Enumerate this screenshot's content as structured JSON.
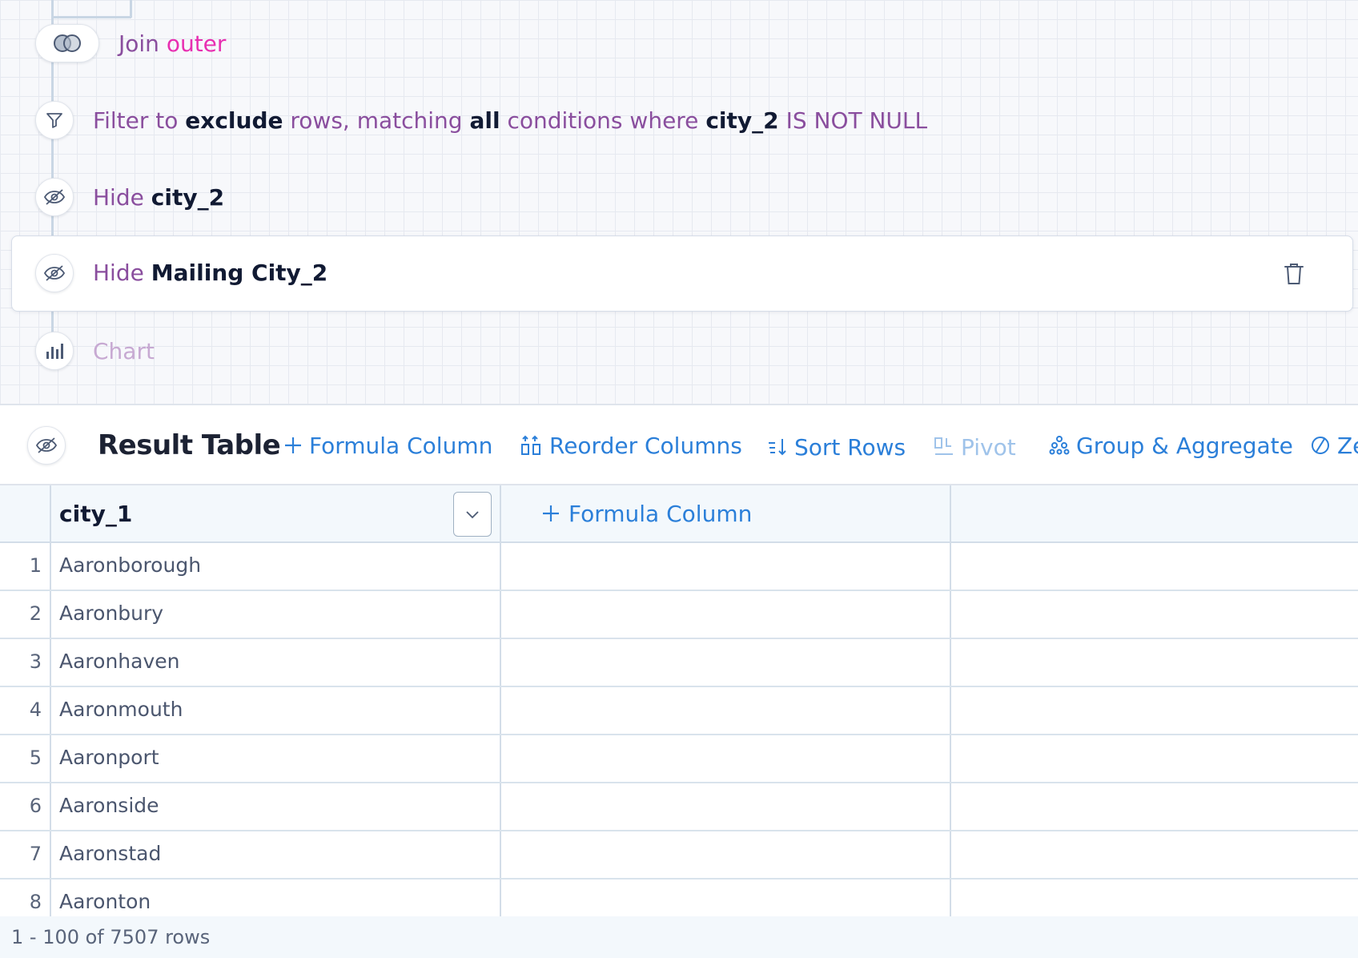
{
  "pipeline": {
    "join": {
      "prefix": "Join",
      "type": "outer"
    },
    "filter": {
      "parts": [
        "Filter to",
        "exclude",
        "rows, matching",
        "all",
        "conditions where",
        "city_2",
        "IS NOT NULL"
      ]
    },
    "hide1": {
      "verb": "Hide",
      "column": "city_2"
    },
    "hide2": {
      "verb": "Hide",
      "column": "Mailing City_2"
    },
    "chart": {
      "label": "Chart"
    }
  },
  "result": {
    "title": "Result Table",
    "toolbar": {
      "formula": "Formula Column",
      "reorder": "Reorder Columns",
      "sort": "Sort Rows",
      "pivot": "Pivot",
      "group": "Group & Aggregate",
      "ze": "Ze"
    }
  },
  "table": {
    "column1": "city_1",
    "formula_column": "Formula Column",
    "rows": [
      {
        "num": "1",
        "value": "Aaronborough"
      },
      {
        "num": "2",
        "value": "Aaronbury"
      },
      {
        "num": "3",
        "value": "Aaronhaven"
      },
      {
        "num": "4",
        "value": "Aaronmouth"
      },
      {
        "num": "5",
        "value": "Aaronport"
      },
      {
        "num": "6",
        "value": "Aaronside"
      },
      {
        "num": "7",
        "value": "Aaronstad"
      },
      {
        "num": "8",
        "value": "Aaronton"
      }
    ]
  },
  "footer": {
    "rows_label": "1 - 100 of 7507 rows"
  },
  "colors": {
    "accent": "#2b7fd9",
    "step_text": "#8a4e9e",
    "join_type": "#e82fb1"
  },
  "icons": {
    "join": "venn-circles-icon",
    "filter": "funnel-icon",
    "hide": "eye-slash-icon",
    "chart": "bar-chart-icon",
    "delete": "trash-icon",
    "dropdown": "chevron-down-icon",
    "plus": "plus-icon"
  }
}
